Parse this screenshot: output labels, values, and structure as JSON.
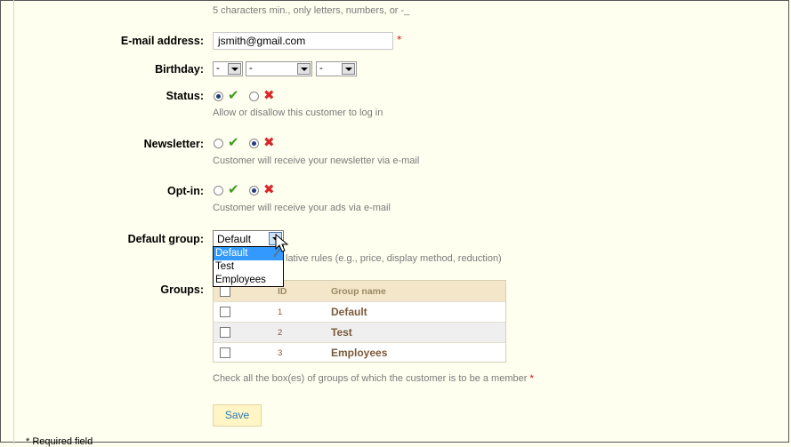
{
  "hints": {
    "username": "5 characters min., only letters, numbers, or -_",
    "status": "Allow or disallow this customer to log in",
    "newsletter": "Customer will receive your newsletter via e-mail",
    "optin": "Customer will receive your ads via e-mail",
    "group": "lative rules (e.g., price, display method, reduction)",
    "groups": "Check all the box(es) of groups of which the customer is to be a member",
    "required": "* Required field"
  },
  "labels": {
    "email": "E-mail address:",
    "birthday": "Birthday:",
    "status": "Status:",
    "newsletter": "Newsletter:",
    "optin": "Opt-in:",
    "default_group": "Default group:",
    "groups": "Groups:"
  },
  "fields": {
    "email_value": "jsmith@gmail.com",
    "required_mark": "*",
    "birthday_day": "-",
    "birthday_month": "-",
    "birthday_year": "-"
  },
  "default_group": {
    "selected": "Default",
    "options": [
      "Default",
      "Test",
      "Employees"
    ]
  },
  "groups_table": {
    "headers": [
      "ID",
      "Group name"
    ],
    "rows": [
      {
        "id": "1",
        "name": "Default"
      },
      {
        "id": "2",
        "name": "Test"
      },
      {
        "id": "3",
        "name": "Employees"
      }
    ]
  },
  "buttons": {
    "save": "Save"
  },
  "icons": {
    "enabled": "check-icon",
    "disabled": "cross-icon"
  },
  "colors": {
    "accent": "#3399ff",
    "check": "#3f9b1f",
    "cross": "#d8282a",
    "required": "#cc0000"
  }
}
